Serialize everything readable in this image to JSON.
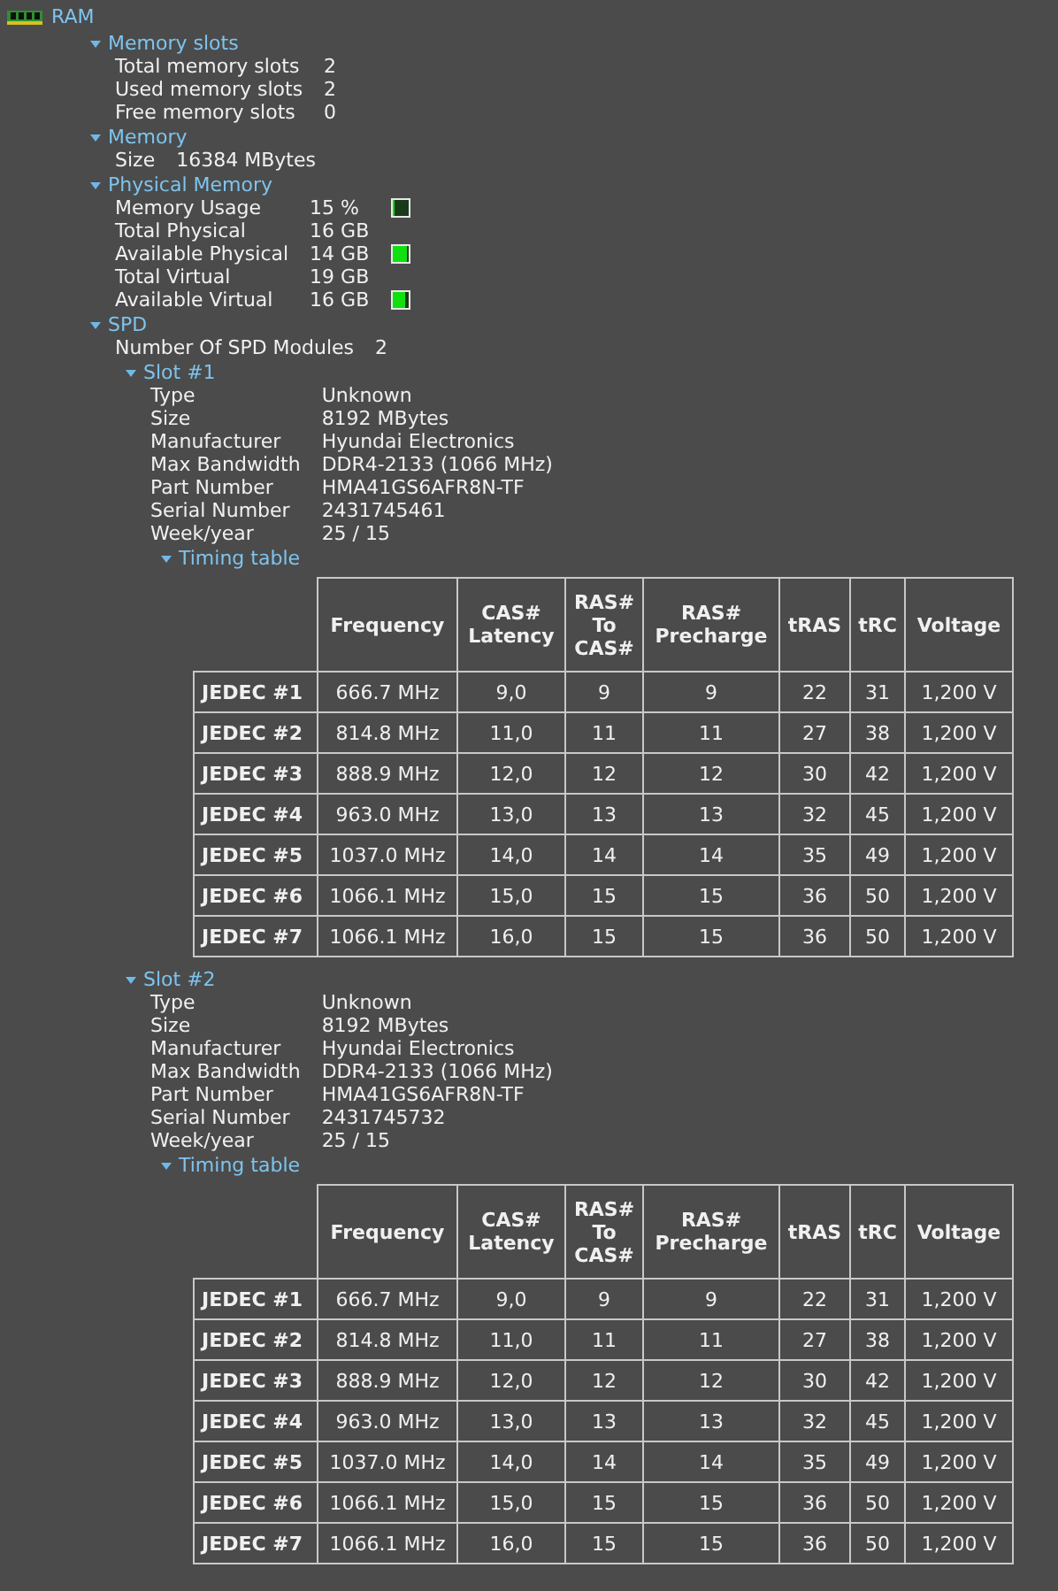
{
  "tree": {
    "label": "RAM",
    "children": [
      {
        "kind": "group",
        "label": "Memory slots",
        "expanded": true,
        "children": [
          {
            "kind": "prop",
            "name": "Total memory slots",
            "value": "2"
          },
          {
            "kind": "prop",
            "name": "Used memory slots",
            "value": "2"
          },
          {
            "kind": "prop",
            "name": "Free memory slots",
            "value": "0"
          }
        ]
      },
      {
        "kind": "group",
        "label": "Memory",
        "expanded": true,
        "children": [
          {
            "kind": "prop",
            "name": "Size",
            "value": "16384 MBytes"
          }
        ]
      },
      {
        "kind": "group",
        "label": "Physical Memory",
        "expanded": true,
        "children": [
          {
            "kind": "prop",
            "name": "Memory Usage",
            "value": "15 %",
            "meter": {
              "level": 0.15
            }
          },
          {
            "kind": "prop",
            "name": "Total Physical",
            "value": "16 GB"
          },
          {
            "kind": "prop",
            "name": "Available Physical",
            "value": "14 GB",
            "meter": {
              "level": 0.875
            }
          },
          {
            "kind": "prop",
            "name": "Total Virtual",
            "value": "19 GB"
          },
          {
            "kind": "prop",
            "name": "Available Virtual",
            "value": "16 GB",
            "meter": {
              "level": 0.84
            }
          }
        ]
      },
      {
        "kind": "group",
        "label": "SPD",
        "expanded": true,
        "children": [
          {
            "kind": "prop",
            "name": "Number Of SPD Modules",
            "value": "2"
          },
          {
            "kind": "group",
            "label": "Slot #1",
            "expanded": true,
            "children": [
              {
                "kind": "prop",
                "name": "Type",
                "value": "Unknown"
              },
              {
                "kind": "prop",
                "name": "Size",
                "value": "8192 MBytes"
              },
              {
                "kind": "prop",
                "name": "Manufacturer",
                "value": "Hyundai Electronics"
              },
              {
                "kind": "prop",
                "name": "Max Bandwidth",
                "value": "DDR4-2133 (1066 MHz)"
              },
              {
                "kind": "prop",
                "name": "Part Number",
                "value": "HMA41GS6AFR8N-TF"
              },
              {
                "kind": "prop",
                "name": "Serial Number",
                "value": "2431745461"
              },
              {
                "kind": "prop",
                "name": "Week/year",
                "value": "25 / 15"
              },
              {
                "kind": "group",
                "label": "Timing table",
                "expanded": true,
                "children": [
                  {
                    "kind": "table",
                    "columns": [
                      "Frequency",
                      "CAS# Latency",
                      "RAS# To CAS#",
                      "RAS# Precharge",
                      "tRAS",
                      "tRC",
                      "Voltage"
                    ],
                    "rows": [
                      {
                        "label": "JEDEC #1",
                        "cells": [
                          "666.7 MHz",
                          "9,0",
                          "9",
                          "9",
                          "22",
                          "31",
                          "1,200 V"
                        ]
                      },
                      {
                        "label": "JEDEC #2",
                        "cells": [
                          "814.8 MHz",
                          "11,0",
                          "11",
                          "11",
                          "27",
                          "38",
                          "1,200 V"
                        ]
                      },
                      {
                        "label": "JEDEC #3",
                        "cells": [
                          "888.9 MHz",
                          "12,0",
                          "12",
                          "12",
                          "30",
                          "42",
                          "1,200 V"
                        ]
                      },
                      {
                        "label": "JEDEC #4",
                        "cells": [
                          "963.0 MHz",
                          "13,0",
                          "13",
                          "13",
                          "32",
                          "45",
                          "1,200 V"
                        ]
                      },
                      {
                        "label": "JEDEC #5",
                        "cells": [
                          "1037.0 MHz",
                          "14,0",
                          "14",
                          "14",
                          "35",
                          "49",
                          "1,200 V"
                        ]
                      },
                      {
                        "label": "JEDEC #6",
                        "cells": [
                          "1066.1 MHz",
                          "15,0",
                          "15",
                          "15",
                          "36",
                          "50",
                          "1,200 V"
                        ]
                      },
                      {
                        "label": "JEDEC #7",
                        "cells": [
                          "1066.1 MHz",
                          "16,0",
                          "15",
                          "15",
                          "36",
                          "50",
                          "1,200 V"
                        ]
                      }
                    ]
                  }
                ]
              }
            ]
          },
          {
            "kind": "group",
            "label": "Slot #2",
            "expanded": true,
            "children": [
              {
                "kind": "prop",
                "name": "Type",
                "value": "Unknown"
              },
              {
                "kind": "prop",
                "name": "Size",
                "value": "8192 MBytes"
              },
              {
                "kind": "prop",
                "name": "Manufacturer",
                "value": "Hyundai Electronics"
              },
              {
                "kind": "prop",
                "name": "Max Bandwidth",
                "value": "DDR4-2133 (1066 MHz)"
              },
              {
                "kind": "prop",
                "name": "Part Number",
                "value": "HMA41GS6AFR8N-TF"
              },
              {
                "kind": "prop",
                "name": "Serial Number",
                "value": "2431745732"
              },
              {
                "kind": "prop",
                "name": "Week/year",
                "value": "25 / 15"
              },
              {
                "kind": "group",
                "label": "Timing table",
                "expanded": true,
                "children": [
                  {
                    "kind": "table",
                    "columns": [
                      "Frequency",
                      "CAS# Latency",
                      "RAS# To CAS#",
                      "RAS# Precharge",
                      "tRAS",
                      "tRC",
                      "Voltage"
                    ],
                    "rows": [
                      {
                        "label": "JEDEC #1",
                        "cells": [
                          "666.7 MHz",
                          "9,0",
                          "9",
                          "9",
                          "22",
                          "31",
                          "1,200 V"
                        ]
                      },
                      {
                        "label": "JEDEC #2",
                        "cells": [
                          "814.8 MHz",
                          "11,0",
                          "11",
                          "11",
                          "27",
                          "38",
                          "1,200 V"
                        ]
                      },
                      {
                        "label": "JEDEC #3",
                        "cells": [
                          "888.9 MHz",
                          "12,0",
                          "12",
                          "12",
                          "30",
                          "42",
                          "1,200 V"
                        ]
                      },
                      {
                        "label": "JEDEC #4",
                        "cells": [
                          "963.0 MHz",
                          "13,0",
                          "13",
                          "13",
                          "32",
                          "45",
                          "1,200 V"
                        ]
                      },
                      {
                        "label": "JEDEC #5",
                        "cells": [
                          "1037.0 MHz",
                          "14,0",
                          "14",
                          "14",
                          "35",
                          "49",
                          "1,200 V"
                        ]
                      },
                      {
                        "label": "JEDEC #6",
                        "cells": [
                          "1066.1 MHz",
                          "15,0",
                          "15",
                          "15",
                          "36",
                          "50",
                          "1,200 V"
                        ]
                      },
                      {
                        "label": "JEDEC #7",
                        "cells": [
                          "1066.1 MHz",
                          "16,0",
                          "15",
                          "15",
                          "36",
                          "50",
                          "1,200 V"
                        ]
                      }
                    ]
                  }
                ]
              }
            ]
          }
        ]
      }
    ]
  }
}
